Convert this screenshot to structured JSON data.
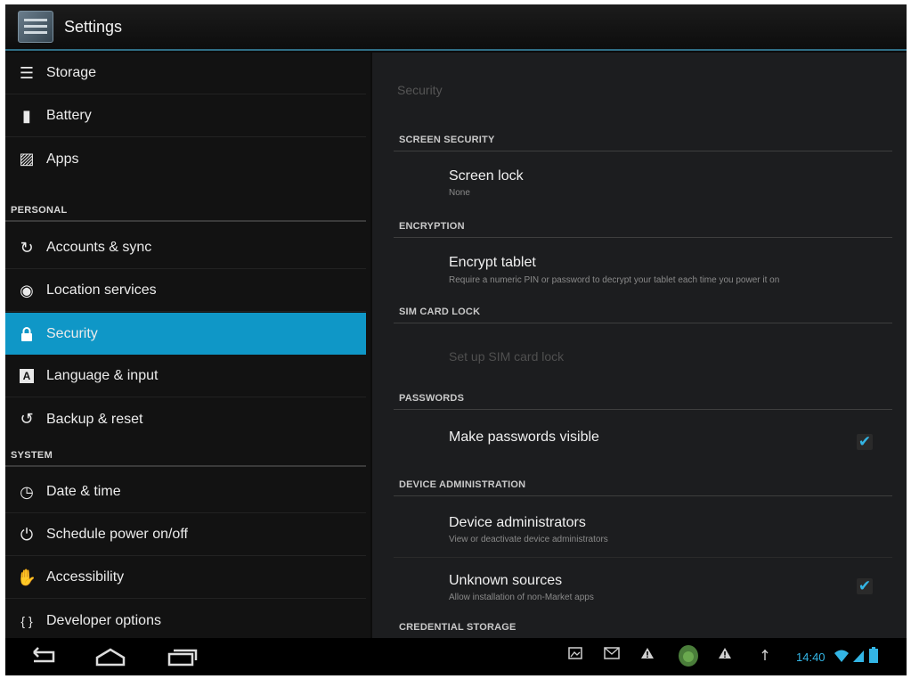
{
  "app": {
    "title": "Settings"
  },
  "left": {
    "items_top": [
      {
        "label": "Storage",
        "icon": "storage-icon",
        "glyph": "☰"
      },
      {
        "label": "Battery",
        "icon": "battery-icon",
        "glyph": "▮"
      },
      {
        "label": "Apps",
        "icon": "apps-icon",
        "glyph": "▨"
      }
    ],
    "personal_header": "PERSONAL",
    "items_personal": [
      {
        "label": "Accounts & sync",
        "icon": "sync-icon",
        "glyph": "↻"
      },
      {
        "label": "Location services",
        "icon": "location-icon",
        "glyph": "◉"
      },
      {
        "label": "Security",
        "icon": "lock-icon",
        "glyph": "🔒",
        "selected": true
      },
      {
        "label": "Language & input",
        "icon": "language-icon",
        "glyph": "A"
      },
      {
        "label": "Backup & reset",
        "icon": "backup-icon",
        "glyph": "↺"
      }
    ],
    "system_header": "SYSTEM",
    "items_system": [
      {
        "label": "Date & time",
        "icon": "clock-icon",
        "glyph": "◷"
      },
      {
        "label": "Schedule power on/off",
        "icon": "power-schedule-icon",
        "glyph": "⏻"
      },
      {
        "label": "Accessibility",
        "icon": "hand-icon",
        "glyph": "✋"
      },
      {
        "label": "Developer options",
        "icon": "braces-icon",
        "glyph": "{ }"
      }
    ]
  },
  "right": {
    "breadcrumb": "Security",
    "screen_security": {
      "header": "SCREEN SECURITY",
      "screen_lock_title": "Screen lock",
      "screen_lock_summary": "None"
    },
    "encryption": {
      "header": "ENCRYPTION",
      "title": "Encrypt tablet",
      "summary": "Require a numeric PIN or password to decrypt your tablet each time you power it on"
    },
    "sim_card_lock": {
      "header": "SIM CARD LOCK",
      "title": "Set up SIM card lock"
    },
    "passwords": {
      "header": "PASSWORDS",
      "title": "Make passwords visible",
      "checked": true
    },
    "device_admin": {
      "header": "DEVICE ADMINISTRATION",
      "admins_title": "Device administrators",
      "admins_summary": "View or deactivate device administrators",
      "unknown_title": "Unknown sources",
      "unknown_summary": "Allow installation of non-Market apps",
      "unknown_checked": true
    },
    "credential_storage": {
      "header": "CREDENTIAL STORAGE"
    }
  },
  "navbar": {
    "clock": "14:40"
  },
  "colors": {
    "accent": "#33b5e5",
    "selected_row": "#0f97c7",
    "action_bar_line": "#2f6e85"
  }
}
